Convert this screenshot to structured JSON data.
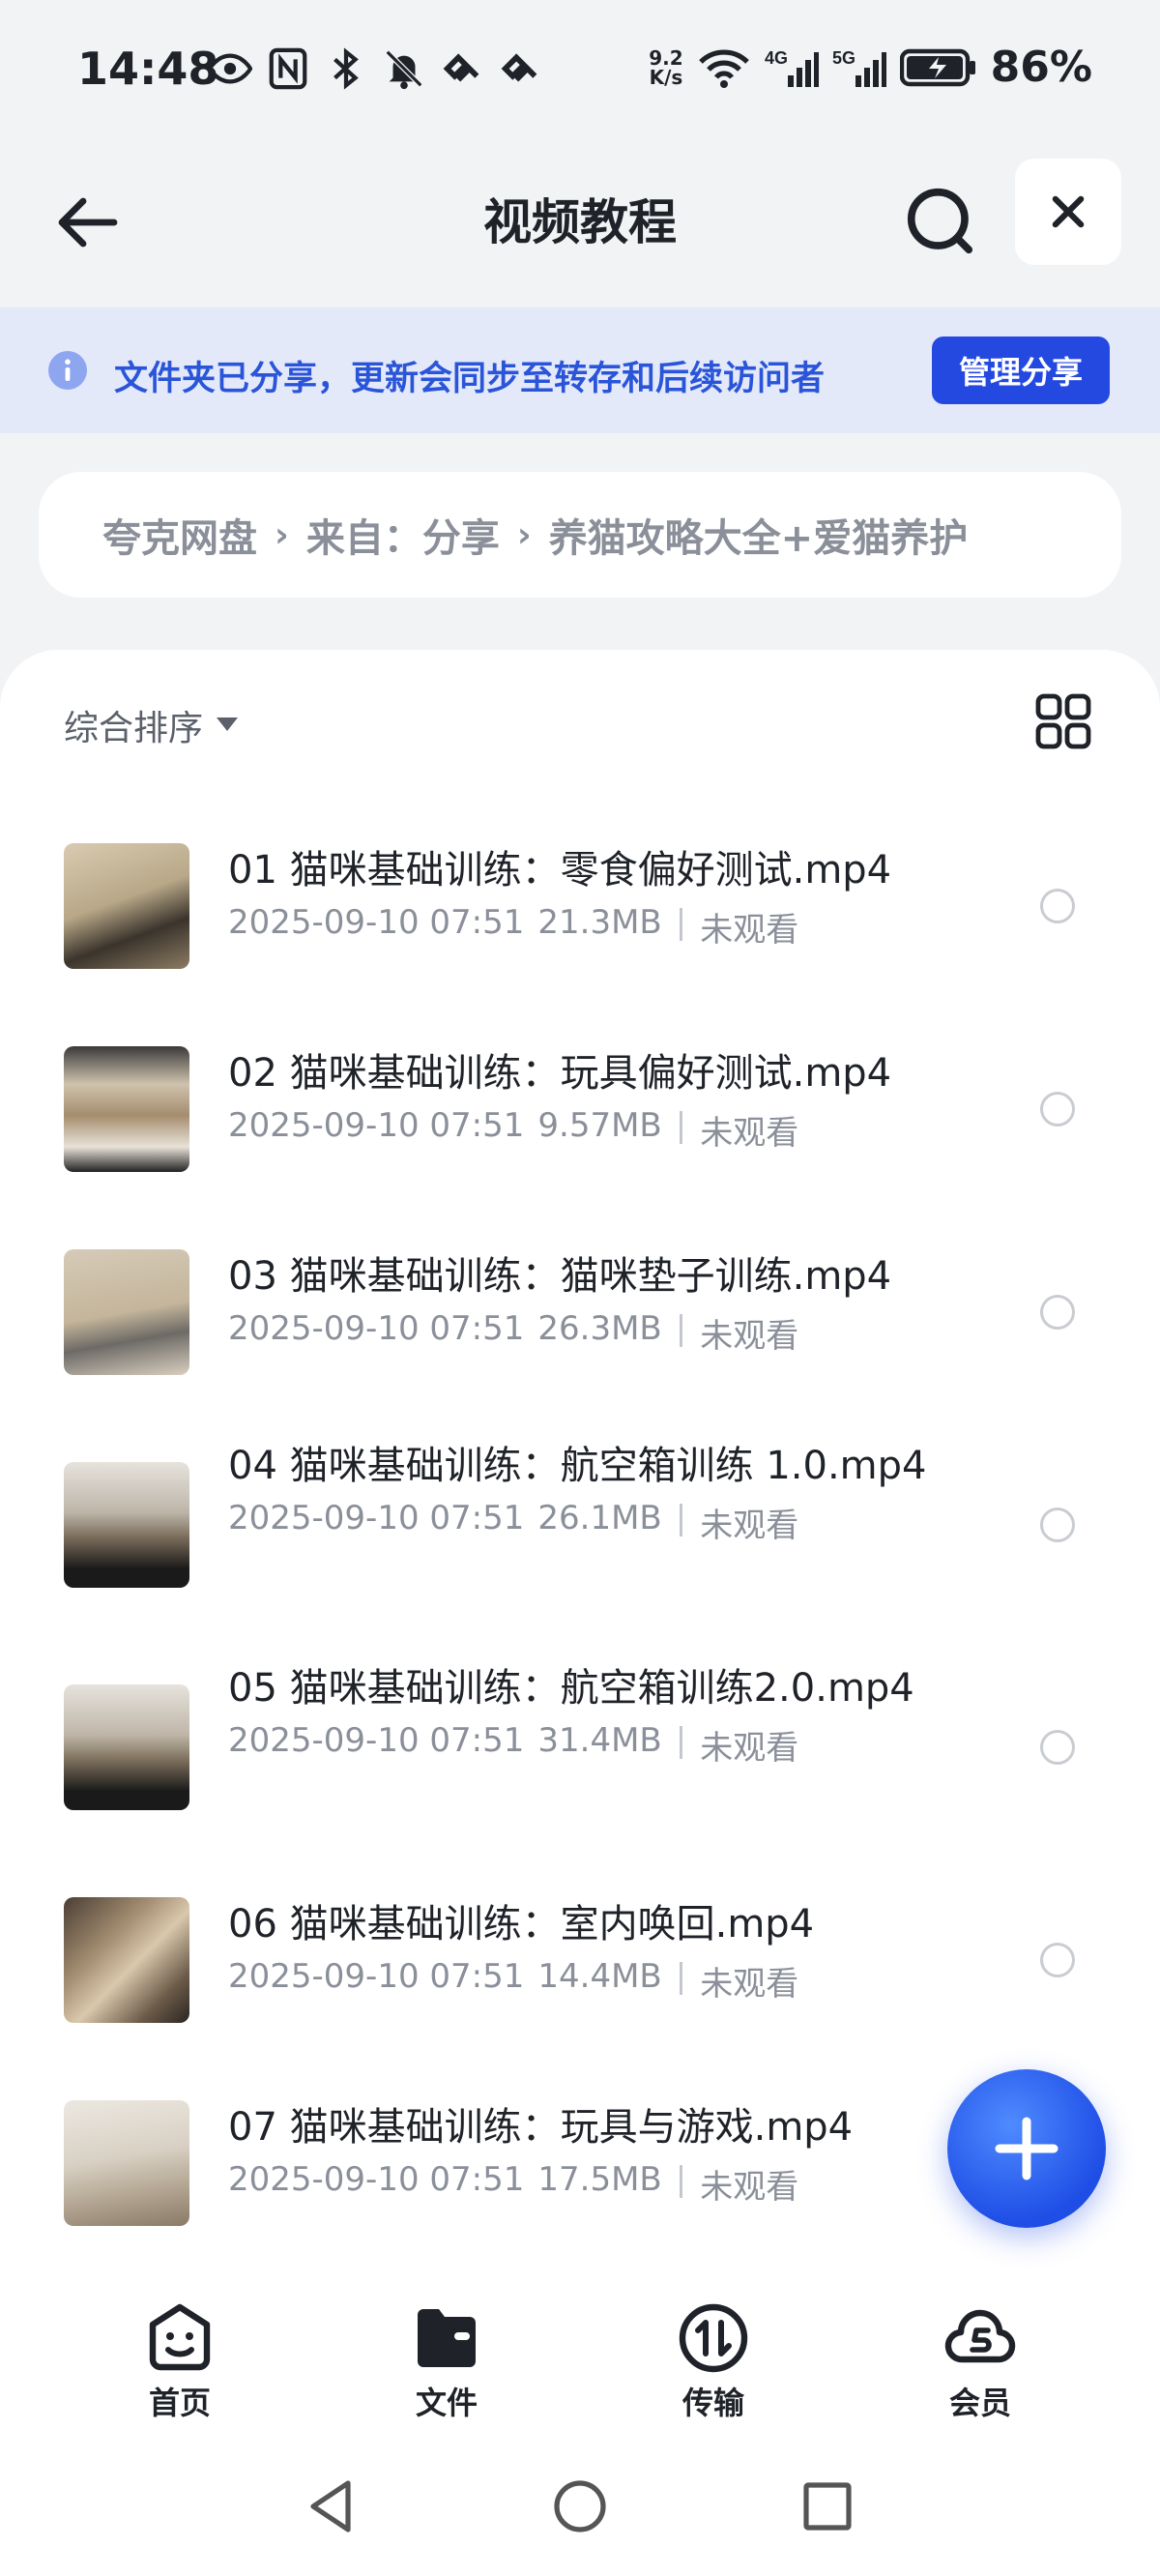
{
  "status_bar": {
    "time": "14:48",
    "net_speed_value": "9.2",
    "net_speed_unit": "K/s",
    "battery_percent": "86%"
  },
  "header": {
    "title": "视频教程"
  },
  "share_banner": {
    "text": "文件夹已分享，更新会同步至转存和后续访问者",
    "button_label": "管理分享"
  },
  "breadcrumb": {
    "items": [
      "夸克网盘",
      "来自：分享",
      "养猫攻略大全+爱猫养护"
    ]
  },
  "toolbar": {
    "sort_label": "综合排序"
  },
  "files": [
    {
      "name": "01 猫咪基础训练：零食偏好测试.mp4",
      "date": "2025-09-10 07:51",
      "size": "21.3MB",
      "status": "未观看"
    },
    {
      "name": "02 猫咪基础训练：玩具偏好测试.mp4",
      "date": "2025-09-10 07:51",
      "size": "9.57MB",
      "status": "未观看"
    },
    {
      "name": "03 猫咪基础训练：猫咪垫子训练.mp4",
      "date": "2025-09-10 07:51",
      "size": "26.3MB",
      "status": "未观看"
    },
    {
      "name": "04 猫咪基础训练：航空箱训练 1.0.mp4",
      "date": "2025-09-10 07:51",
      "size": "26.1MB",
      "status": "未观看"
    },
    {
      "name": "05 猫咪基础训练：航空箱训练2.0.mp4",
      "date": "2025-09-10 07:51",
      "size": "31.4MB",
      "status": "未观看"
    },
    {
      "name": "06 猫咪基础训练：室内唤回.mp4",
      "date": "2025-09-10 07:51",
      "size": "14.4MB",
      "status": "未观看"
    },
    {
      "name": "07 猫咪基础训练：玩具与游戏.mp4",
      "date": "2025-09-10 07:51",
      "size": "17.5MB",
      "status": "未观看"
    }
  ],
  "bottom_nav": {
    "items": [
      {
        "label": "首页",
        "icon": "smile-home-icon"
      },
      {
        "label": "文件",
        "icon": "folder-icon"
      },
      {
        "label": "传输",
        "icon": "transfer-icon"
      },
      {
        "label": "会员",
        "icon": "cloud-vip-icon"
      }
    ]
  },
  "colors": {
    "accent": "#2449e0",
    "banner_bg": "#e4e9fa",
    "banner_text": "#2a55d9"
  }
}
